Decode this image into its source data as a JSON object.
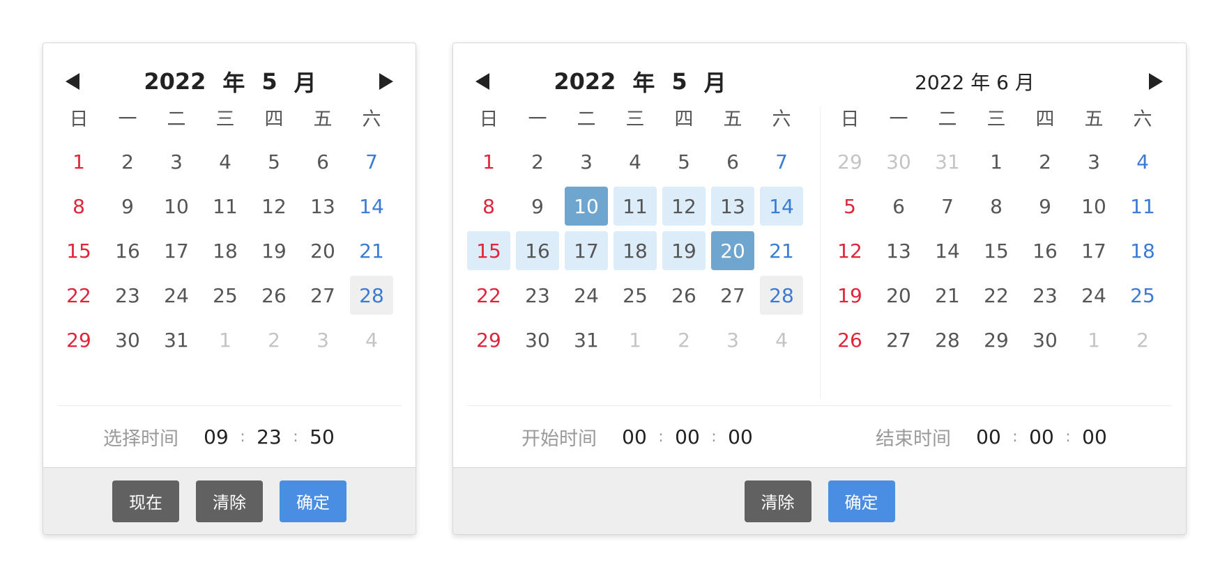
{
  "weekdays": [
    "日",
    "一",
    "二",
    "三",
    "四",
    "五",
    "六"
  ],
  "colors": {
    "sunday": "#e0253a",
    "saturday": "#3a7bd5",
    "other_month": "#c4c4c4",
    "range_fill": "#dcecf9",
    "range_endpoint": "#6ea6cf",
    "primary": "#4a8ee3",
    "secondary": "#616161"
  },
  "single": {
    "header": {
      "year": "2022",
      "year_unit": "年",
      "month": "5",
      "month_unit": "月"
    },
    "calendar": {
      "days": [
        "1",
        "2",
        "3",
        "4",
        "5",
        "6",
        "7",
        "8",
        "9",
        "10",
        "11",
        "12",
        "13",
        "14",
        "15",
        "16",
        "17",
        "18",
        "19",
        "20",
        "21",
        "22",
        "23",
        "24",
        "25",
        "26",
        "27",
        "28",
        "29",
        "30",
        "31",
        "1",
        "2",
        "3",
        "4"
      ],
      "other_month_indices": [
        31,
        32,
        33,
        34
      ],
      "today_index": 27
    },
    "time": {
      "label": "选择时间",
      "hour": "09",
      "minute": "23",
      "second": "50",
      "sep": ":"
    },
    "buttons": {
      "now": "现在",
      "clear": "清除",
      "confirm": "确定"
    }
  },
  "range": {
    "left": {
      "header": {
        "year": "2022",
        "year_unit": "年",
        "month": "5",
        "month_unit": "月"
      },
      "calendar": {
        "days": [
          "1",
          "2",
          "3",
          "4",
          "5",
          "6",
          "7",
          "8",
          "9",
          "10",
          "11",
          "12",
          "13",
          "14",
          "15",
          "16",
          "17",
          "18",
          "19",
          "20",
          "21",
          "22",
          "23",
          "24",
          "25",
          "26",
          "27",
          "28",
          "29",
          "30",
          "31",
          "1",
          "2",
          "3",
          "4"
        ],
        "other_month_indices": [
          31,
          32,
          33,
          34
        ],
        "today_index": 27,
        "range_start_index": 9,
        "range_end_index": 19
      }
    },
    "right": {
      "header": {
        "text": "2022 年 6 月"
      },
      "calendar": {
        "days": [
          "29",
          "30",
          "31",
          "1",
          "2",
          "3",
          "4",
          "5",
          "6",
          "7",
          "8",
          "9",
          "10",
          "11",
          "12",
          "13",
          "14",
          "15",
          "16",
          "17",
          "18",
          "19",
          "20",
          "21",
          "22",
          "23",
          "24",
          "25",
          "26",
          "27",
          "28",
          "29",
          "30",
          "1",
          "2"
        ],
        "other_month_indices": [
          0,
          1,
          2,
          33,
          34
        ]
      }
    },
    "start_time": {
      "label": "开始时间",
      "hour": "00",
      "minute": "00",
      "second": "00",
      "sep": ":"
    },
    "end_time": {
      "label": "结束时间",
      "hour": "00",
      "minute": "00",
      "second": "00",
      "sep": ":"
    },
    "buttons": {
      "clear": "清除",
      "confirm": "确定"
    }
  }
}
